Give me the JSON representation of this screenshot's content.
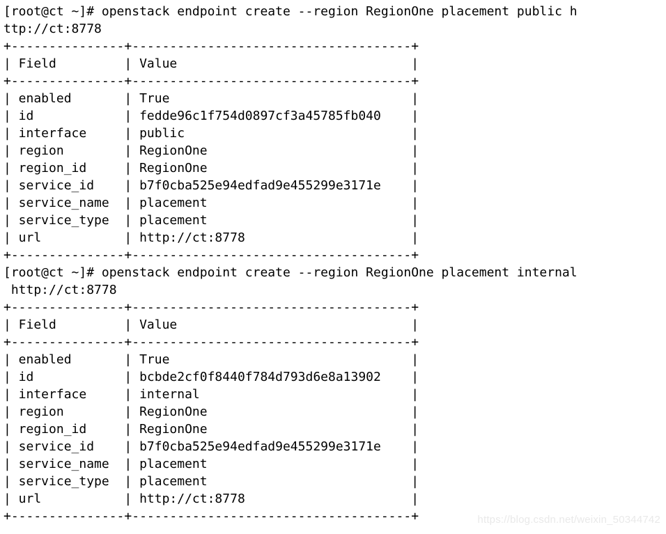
{
  "terminal": {
    "prompt": "[root@ct ~]#",
    "watermark": "https://blog.csdn.net/weixin_50344742",
    "columns": 55,
    "field_col_width": 16,
    "value_col_width": 37,
    "colors": {
      "background": "#ffffff",
      "foreground": "#000000",
      "watermark": "#e9e9e9"
    },
    "lines": [
      "[root@ct ~]# openstack endpoint create --region RegionOne placement public h",
      "ttp://ct:8778",
      "+---------------+-------------------------------------+",
      "| Field         | Value                               |",
      "+---------------+-------------------------------------+",
      "| enabled       | True                                |",
      "| id            | fedde96c1f754d0897cf3a45785fb040    |",
      "| interface     | public                              |",
      "| region        | RegionOne                           |",
      "| region_id     | RegionOne                           |",
      "| service_id    | b7f0cba525e94edfad9e455299e3171e    |",
      "| service_name  | placement                           |",
      "| service_type  | placement                           |",
      "| url           | http://ct:8778                      |",
      "+---------------+-------------------------------------+",
      "[root@ct ~]# openstack endpoint create --region RegionOne placement internal",
      " http://ct:8778",
      "+---------------+-------------------------------------+",
      "| Field         | Value                               |",
      "+---------------+-------------------------------------+",
      "| enabled       | True                                |",
      "| id            | bcbde2cf0f8440f784d793d6e8a13902    |",
      "| interface     | internal                            |",
      "| region        | RegionOne                           |",
      "| region_id     | RegionOne                           |",
      "| service_id    | b7f0cba525e94edfad9e455299e3171e    |",
      "| service_name  | placement                           |",
      "| service_type  | placement                           |",
      "| url           | http://ct:8778                      |",
      "+---------------+-------------------------------------+"
    ],
    "commands": [
      {
        "name": "create-placement-public-endpoint",
        "text": "openstack endpoint create --region RegionOne placement public http://ct:8778",
        "service": "placement",
        "interface": "public",
        "region": "RegionOne",
        "url": "http://ct:8778"
      },
      {
        "name": "create-placement-internal-endpoint",
        "text": "openstack endpoint create --region RegionOne placement internal http://ct:8778",
        "service": "placement",
        "interface": "internal",
        "region": "RegionOne",
        "url": "http://ct:8778"
      }
    ],
    "tables": [
      {
        "name": "placement-public-endpoint-table",
        "headers": [
          "Field",
          "Value"
        ],
        "rows": [
          [
            "enabled",
            "True"
          ],
          [
            "id",
            "fedde96c1f754d0897cf3a45785fb040"
          ],
          [
            "interface",
            "public"
          ],
          [
            "region",
            "RegionOne"
          ],
          [
            "region_id",
            "RegionOne"
          ],
          [
            "service_id",
            "b7f0cba525e94edfad9e455299e3171e"
          ],
          [
            "service_name",
            "placement"
          ],
          [
            "service_type",
            "placement"
          ],
          [
            "url",
            "http://ct:8778"
          ]
        ]
      },
      {
        "name": "placement-internal-endpoint-table",
        "headers": [
          "Field",
          "Value"
        ],
        "rows": [
          [
            "enabled",
            "True"
          ],
          [
            "id",
            "bcbde2cf0f8440f784d793d6e8a13902"
          ],
          [
            "interface",
            "internal"
          ],
          [
            "region",
            "RegionOne"
          ],
          [
            "region_id",
            "RegionOne"
          ],
          [
            "service_id",
            "b7f0cba525e94edfad9e455299e3171e"
          ],
          [
            "service_name",
            "placement"
          ],
          [
            "service_type",
            "placement"
          ],
          [
            "url",
            "http://ct:8778"
          ]
        ]
      }
    ]
  }
}
